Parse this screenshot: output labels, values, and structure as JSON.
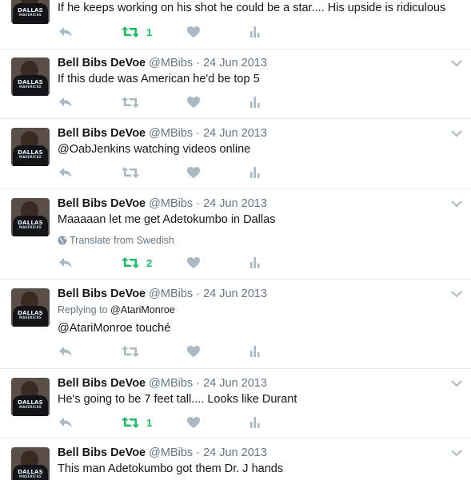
{
  "colors": {
    "text": "#14171a",
    "secondary": "#657786",
    "icon": "#aab8c2",
    "retweeted": "#17bf63",
    "divider": "#e6ecf0"
  },
  "icons": [
    "reply-icon",
    "retweet-icon",
    "like-icon",
    "analytics-icon",
    "chevron-down-icon",
    "globe-icon"
  ],
  "top_tweet": {
    "text": "If he keeps working on his shot he could be a star.... His upside is ridiculous",
    "retweets": "1",
    "avatar_text": "DALLAS",
    "avatar_sub": "MAVERICKS"
  },
  "tweets": [
    {
      "name": "Bell Bibs DeVoe",
      "handle": "@MBibs",
      "dot": "·",
      "date": "24 Jun 2013",
      "text": "If this dude was American he'd be top 5",
      "avatar_text": "DALLAS",
      "avatar_sub": "MAVERICKS"
    },
    {
      "name": "Bell Bibs DeVoe",
      "handle": "@MBibs",
      "dot": "·",
      "date": "24 Jun 2013",
      "text": "@OabJenkins watching videos online",
      "avatar_text": "DALLAS",
      "avatar_sub": "MAVERICKS"
    },
    {
      "name": "Bell Bibs DeVoe",
      "handle": "@MBibs",
      "dot": "·",
      "date": "24 Jun 2013",
      "text": "Maaaaan let me get Adetokumbo in Dallas",
      "translate": "Translate from Swedish",
      "retweets": "2",
      "avatar_text": "DALLAS",
      "avatar_sub": "MAVERICKS"
    },
    {
      "name": "Bell Bibs DeVoe",
      "handle": "@MBibs",
      "dot": "·",
      "date": "24 Jun 2013",
      "replying_label": "Replying to",
      "replying_to": "@AtariMonroe",
      "text": "@AtariMonroe touché",
      "avatar_text": "DALLAS",
      "avatar_sub": "MAVERICKS"
    },
    {
      "name": "Bell Bibs DeVoe",
      "handle": "@MBibs",
      "dot": "·",
      "date": "24 Jun 2013",
      "text": "He's going to be 7 feet tall.... Looks like Durant",
      "retweets": "1",
      "avatar_text": "DALLAS",
      "avatar_sub": "MAVERICKS"
    },
    {
      "name": "Bell Bibs DeVoe",
      "handle": "@MBibs",
      "dot": "·",
      "date": "24 Jun 2013",
      "text": "This man Adetokumbo got them Dr. J hands",
      "avatar_text": "DALLAS",
      "avatar_sub": "MAVERICKS"
    }
  ]
}
